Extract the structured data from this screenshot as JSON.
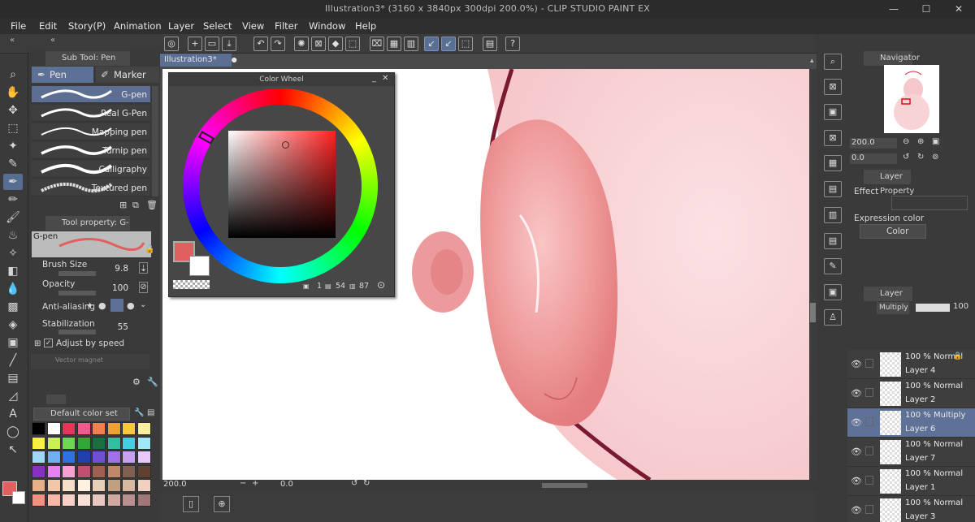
{
  "window": {
    "title": "Illustration3* (3160 x 3840px 300dpi 200.0%) - CLIP STUDIO PAINT EX",
    "minimize": "—",
    "maximize": "☐",
    "close": "✕"
  },
  "menu": [
    "File",
    "Edit",
    "Story(P)",
    "Animation",
    "Layer",
    "Select",
    "View",
    "Filter",
    "Window",
    "Help"
  ],
  "doc_tab": {
    "label": "Illustration3*",
    "close": "●"
  },
  "subtool": {
    "header": "Sub Tool: Pen",
    "group_pen": "Pen",
    "group_marker": "Marker",
    "brushes": [
      "G-pen",
      "Real G-Pen",
      "Mapping pen",
      "Turnip pen",
      "Calligraphy",
      "Textured pen"
    ]
  },
  "toolprop": {
    "header": "Tool property: G-pen",
    "preview_label": "G-pen",
    "brush_size_label": "Brush Size",
    "brush_size": "9.8",
    "opacity_label": "Opacity",
    "opacity": "100",
    "antialias_label": "Anti-aliasing",
    "stabilization_label": "Stabilization",
    "stabilization": "55",
    "adjust_speed_label": "Adjust by speed",
    "vector_magnet_label": "Vector magnet"
  },
  "colorset": {
    "name": "Default color set",
    "swatches": [
      "#000000",
      "#ffffff",
      "#e8345a",
      "#f05a8c",
      "#f08050",
      "#f0a030",
      "#f8c838",
      "#f8f0a0",
      "#f8f040",
      "#c8f050",
      "#70d850",
      "#30a838",
      "#187040",
      "#30c0a0",
      "#40d0e0",
      "#a0e8f8",
      "#a0d8f8",
      "#70b0f0",
      "#3070e0",
      "#2040b0",
      "#7050d0",
      "#a070e8",
      "#c8a0f0",
      "#e8c8f8",
      "#8830c0",
      "#e880f0",
      "#f8a0d0",
      "#c05070",
      "#a06050",
      "#c08868",
      "#806050",
      "#604030",
      "#e8b088",
      "#f0c8a8",
      "#f8e0c8",
      "#fff0e0",
      "#e8d0b8",
      "#c0a080",
      "#d8b8a0",
      "#f0d0c0",
      "#f09080",
      "#f8b8a8",
      "#f8d0c8",
      "#f8e0d8",
      "#e8c8c0",
      "#d0a8a0",
      "#b89090",
      "#a07878"
    ]
  },
  "colorwheel": {
    "title": "Color Wheel",
    "h": "1",
    "s": "54",
    "v": "87",
    "main_color": "#e06060",
    "sub_color": "#ffffff"
  },
  "statusbar": {
    "zoom": "200.0",
    "angle": "0.0"
  },
  "navigator": {
    "header": "Navigator",
    "zoom": "200.0",
    "angle": "0.0"
  },
  "layerprop": {
    "header": "Layer Property",
    "effect_label": "Effect",
    "expression_label": "Expression color",
    "expression_value": "Color"
  },
  "layers": {
    "header": "Layer",
    "blend": "Multiply",
    "opacity": "100",
    "items": [
      {
        "mode": "100 % Normal",
        "name": "Layer 4",
        "locked": true,
        "selected": false
      },
      {
        "mode": "100 % Normal",
        "name": "Layer 2",
        "locked": false,
        "selected": false
      },
      {
        "mode": "100 % Multiply",
        "name": "Layer 6",
        "locked": false,
        "selected": true
      },
      {
        "mode": "100 % Normal",
        "name": "Layer 7",
        "locked": false,
        "selected": false
      },
      {
        "mode": "100 % Normal",
        "name": "Layer 1",
        "locked": false,
        "selected": false
      },
      {
        "mode": "100 % Normal",
        "name": "Layer 3",
        "locked": false,
        "selected": false
      }
    ]
  }
}
